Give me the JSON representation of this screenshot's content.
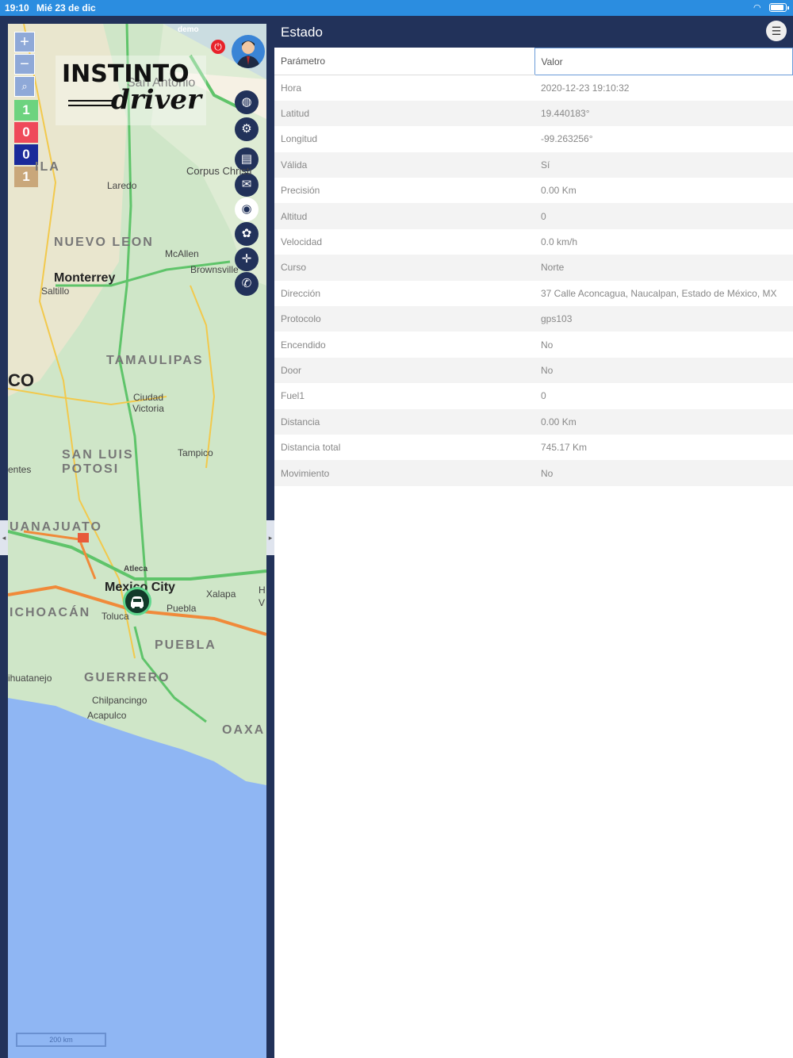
{
  "statusbar": {
    "time": "19:10",
    "date": "Mié 23 de dic",
    "battery_percent": 90
  },
  "map": {
    "zoom_in": "+",
    "zoom_out": "−",
    "counts": [
      {
        "value": "1",
        "color": "#6dd37f"
      },
      {
        "value": "0",
        "color": "#ef4a5a"
      },
      {
        "value": "0",
        "color": "#1a2a9a"
      },
      {
        "value": "1",
        "color": "#c9a77a"
      }
    ],
    "logo": {
      "line1": "INSTINTO",
      "line2": "driver"
    },
    "user": "demo",
    "labels": {
      "san_antonio": "San Antonio",
      "corpus": "Corpus Christi",
      "laredo": "Laredo",
      "nuevo_leon": "NUEVO LEON",
      "mcallen": "McAllen",
      "brownsville": "Brownsville",
      "monterrey": "Monterrey",
      "saltillo": "Saltillo",
      "tamaulipas": "TAMAULIPAS",
      "coahuila": "ILA",
      "co": "CO",
      "ciudad_victoria": "Ciudad Victoria",
      "san_luis": "SAN LUIS POTOSI",
      "tampico": "Tampico",
      "fuentes": "entes",
      "guanajuato": "UANAJUATO",
      "atleca": "Atleca",
      "mexico_city": "Mexico City",
      "xalapa": "Xalapa",
      "michoacan": "ICHOACÁN",
      "toluca": "Toluca",
      "puebla_city": "Puebla",
      "puebla": "PUEBLA",
      "zihuatanejo": "ihuatanejo",
      "guerrero": "GUERRERO",
      "chilpancingo": "Chilpancingo",
      "acapulco": "Acapulco",
      "oaxaca": "OAXA",
      "hv": "H\nV"
    },
    "scale": "200 km",
    "side_buttons": [
      "globe-icon",
      "gear-icon",
      "document-icon",
      "chat-icon",
      "eye-icon",
      "paw-icon",
      "crosshair-icon",
      "whatsapp-icon"
    ]
  },
  "panel": {
    "title": "Estado",
    "columns": [
      "Parámetro",
      "Valor"
    ],
    "rows": [
      [
        "Hora",
        "2020-12-23 19:10:32"
      ],
      [
        "Latitud",
        "19.440183°"
      ],
      [
        "Longitud",
        "-99.263256°"
      ],
      [
        "Válida",
        "Sí"
      ],
      [
        "Precisión",
        "0.00 Km"
      ],
      [
        "Altitud",
        "0"
      ],
      [
        "Velocidad",
        "0.0 km/h"
      ],
      [
        "Curso",
        "Norte"
      ],
      [
        "Dirección",
        "37 Calle Aconcagua, Naucalpan, Estado de México, MX"
      ],
      [
        "Protocolo",
        "gps103"
      ],
      [
        "Encendido",
        "No"
      ],
      [
        "Door",
        "No"
      ],
      [
        "Fuel1",
        "0"
      ],
      [
        "Distancia",
        "0.00 Km"
      ],
      [
        "Distancia total",
        "745.17 Km"
      ],
      [
        "Movimiento",
        "No"
      ]
    ]
  }
}
